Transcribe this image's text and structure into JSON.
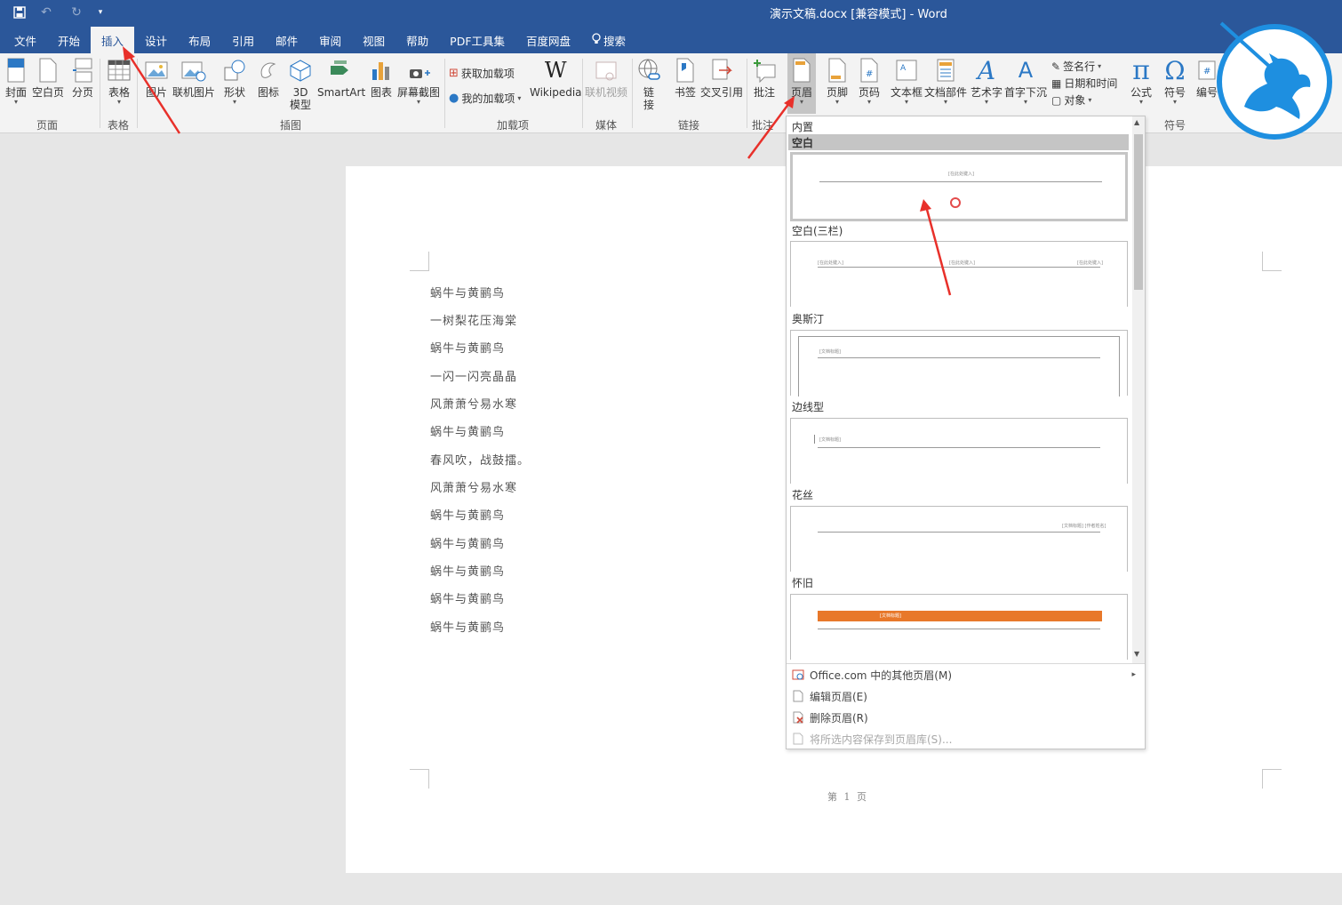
{
  "window": {
    "title": "演示文稿.docx [兼容模式] - Word",
    "accent": "#2b579a"
  },
  "qat": {
    "save_icon": "save-icon",
    "undo_icon": "undo-icon",
    "redo_icon": "redo-icon",
    "customize_icon": "customize-icon"
  },
  "tabs": [
    {
      "label": "文件"
    },
    {
      "label": "开始"
    },
    {
      "label": "插入"
    },
    {
      "label": "设计"
    },
    {
      "label": "布局"
    },
    {
      "label": "引用"
    },
    {
      "label": "邮件"
    },
    {
      "label": "审阅"
    },
    {
      "label": "视图"
    },
    {
      "label": "帮助"
    },
    {
      "label": "PDF工具集"
    },
    {
      "label": "百度网盘"
    },
    {
      "label": "搜索"
    }
  ],
  "ribbon": {
    "groups": {
      "pages": "页面",
      "tables": "表格",
      "illustrations": "插图",
      "addins": "加载项",
      "media": "媒体",
      "links": "链接",
      "comments": "批注",
      "symbols": "符号"
    },
    "buttons": {
      "cover": "封面",
      "blank_page": "空白页",
      "page_break": "分页",
      "table": "表格",
      "picture": "图片",
      "online_picture": "联机图片",
      "shapes": "形状",
      "icons": "图标",
      "model_3d_line1": "3D",
      "model_3d_line2": "模型",
      "smartart": "SmartArt",
      "chart": "图表",
      "screenshot": "屏幕截图",
      "get_addins": "获取加载项",
      "my_addins": "我的加载项",
      "wikipedia": "Wikipedia",
      "online_video": "联机视频",
      "link_line1": "链",
      "link_line2": "接",
      "bookmark": "书签",
      "cross_ref": "交叉引用",
      "comment": "批注",
      "header": "页眉",
      "footer": "页脚",
      "page_number": "页码",
      "text_box": "文本框",
      "quick_parts": "文档部件",
      "wordart": "艺术字",
      "drop_cap": "首字下沉",
      "signature": "签名行",
      "date_time": "日期和时间",
      "object": "对象",
      "equation": "公式",
      "symbol": "符号",
      "number": "编号"
    }
  },
  "document": {
    "lines": [
      "蜗牛与黄鹂鸟",
      "一树梨花压海棠",
      "蜗牛与黄鹂鸟",
      "一闪一闪亮晶晶",
      "风萧萧兮易水寒",
      "蜗牛与黄鹂鸟",
      "春风吹，战鼓擂。",
      "风萧萧兮易水寒",
      "蜗牛与黄鹂鸟",
      "蜗牛与黄鹂鸟",
      "蜗牛与黄鹂鸟",
      "蜗牛与黄鹂鸟",
      "蜗牛与黄鹂鸟"
    ],
    "footer_text": "第 1 页"
  },
  "gallery": {
    "section_title": "内置",
    "items": [
      {
        "name": "空白",
        "thumb_text": "[在此处键入]"
      },
      {
        "name": "空白(三栏)",
        "thumb_text": "[在此处键入]"
      },
      {
        "name": "奥斯汀",
        "thumb_text": "[文档标题]"
      },
      {
        "name": "边线型",
        "thumb_text": "[文档标题]"
      },
      {
        "name": "花丝",
        "thumb_text": "[文档标题] [作者姓名]"
      },
      {
        "name": "怀旧",
        "thumb_text": "[文档标题]"
      }
    ],
    "menu": {
      "more": "Office.com 中的其他页眉(M)",
      "edit": "编辑页眉(E)",
      "remove": "删除页眉(R)",
      "save": "将所选内容保存到页眉库(S)..."
    },
    "retro_color": "#e8782a"
  },
  "logo_color": "#1e8fe0",
  "arrow_color": "#e8302a"
}
